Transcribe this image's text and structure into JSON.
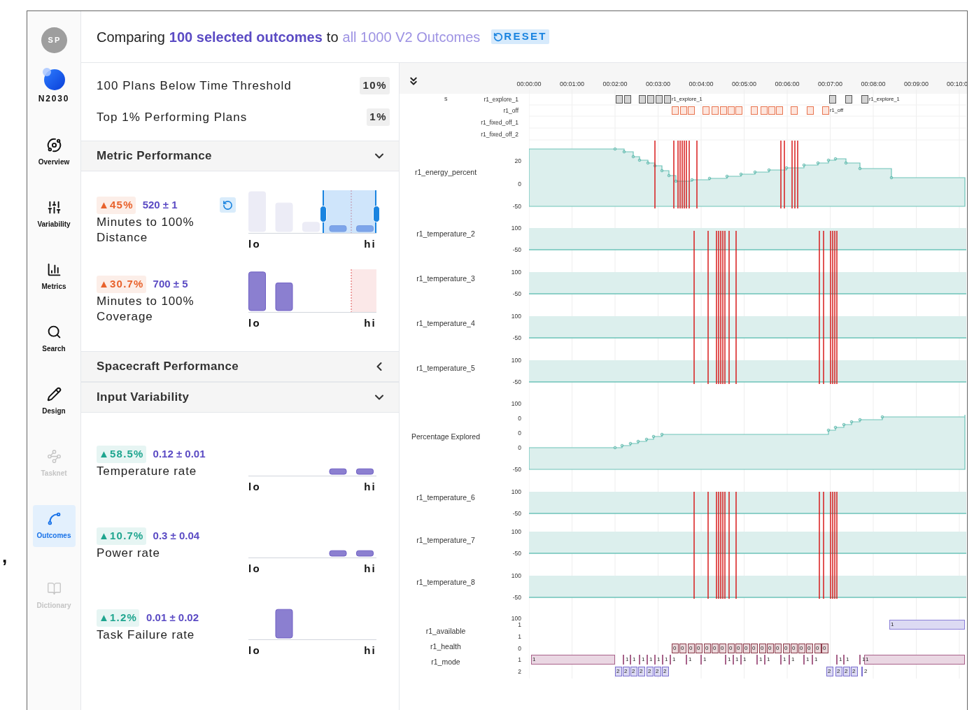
{
  "stray_mark": ",",
  "sidebar": {
    "avatar": "SP",
    "brand": "N2030",
    "items": [
      {
        "label": "Overview",
        "kind": "overview",
        "selected": false,
        "disabled": false
      },
      {
        "label": "Variability",
        "kind": "variability",
        "selected": false,
        "disabled": false
      },
      {
        "label": "Metrics",
        "kind": "metrics",
        "selected": false,
        "disabled": false
      },
      {
        "label": "Search",
        "kind": "search",
        "selected": false,
        "disabled": false
      },
      {
        "label": "Design",
        "kind": "design",
        "selected": false,
        "disabled": false
      },
      {
        "label": "Tasknet",
        "kind": "tasknet",
        "selected": false,
        "disabled": true
      },
      {
        "label": "Outcomes",
        "kind": "outcomes",
        "selected": true,
        "disabled": false
      },
      {
        "label": "Dictionary",
        "kind": "dictionary",
        "selected": false,
        "disabled": true
      }
    ]
  },
  "header": {
    "prefix": "Comparing",
    "selection": "100 selected outcomes",
    "connector": "to",
    "baseline": "all 1000 V2 Outcomes",
    "reset": "RESET"
  },
  "thresholds": [
    {
      "label": "100 Plans Below Time Threshold",
      "value": "10%"
    },
    {
      "label": "Top 1% Performing Plans",
      "value": "1%"
    }
  ],
  "sections": [
    {
      "title": "Metric Performance",
      "expanded": true,
      "items": [
        {
          "delta": "▲45%",
          "color": "#e8622c",
          "value": "520 ± 1",
          "label": "Minutes to 100% Distance",
          "resettable": true,
          "histogram": {
            "kind": "range",
            "lo": "lo",
            "hi": "hi"
          }
        },
        {
          "delta": "▲30.7%",
          "color": "#e8622c",
          "value": "700 ± 5",
          "label": "Minutes to 100% Coverage",
          "resettable": false,
          "histogram": {
            "kind": "threshold",
            "lo": "lo",
            "hi": "hi"
          }
        }
      ]
    },
    {
      "title": "Spacecraft Performance",
      "expanded": false
    },
    {
      "title": "Input Variability",
      "expanded": true,
      "items": [
        {
          "delta": "▲58.5%",
          "color": "#1fa58f",
          "value": "0.12 ± 0.01",
          "label": "Temperature rate",
          "resettable": false,
          "histogram": {
            "kind": "plain",
            "lo": "lo",
            "hi": "hi"
          }
        },
        {
          "delta": "▲10.7%",
          "color": "#1fa58f",
          "value": "0.3 ± 0.04",
          "label": "Power rate",
          "resettable": false,
          "histogram": {
            "kind": "plain",
            "lo": "lo",
            "hi": "hi"
          }
        },
        {
          "delta": "▲1.2%",
          "color": "#1fa58f",
          "value": "0.01 ± 0.02",
          "label": "Task Failure rate",
          "resettable": false,
          "histogram": {
            "kind": "plain",
            "lo": "lo",
            "hi": "hi"
          }
        }
      ]
    }
  ],
  "timeline": {
    "time_ticks": [
      "00:00:00",
      "00:01:00",
      "00:02:00",
      "00:03:00",
      "00:04:00",
      "00:05:00",
      "00:06:00",
      "00:07:00",
      "00:08:00",
      "00:09:00",
      "00:10:0"
    ],
    "group_label": "s",
    "event_tracks": [
      {
        "label": "r1_explore_1",
        "color": "#555555",
        "labels": [
          "r1_explore_1",
          "r1_explore_1"
        ]
      },
      {
        "label": "r1_off",
        "color": "#e8744f",
        "labels": [
          "r1_off"
        ]
      },
      {
        "label": "r1_fixed_off_1"
      },
      {
        "label": "r1_fixed_off_2"
      }
    ],
    "chart_tracks": [
      {
        "kind": "line",
        "label": "r1_energy_percent",
        "ticks": [
          "20",
          "0",
          "-50"
        ]
      },
      {
        "kind": "band",
        "label": "r1_temperature_2",
        "ticks": [
          "100",
          "-50"
        ]
      },
      {
        "kind": "band",
        "label": "r1_temperature_3",
        "ticks": [
          "100",
          "-50"
        ]
      },
      {
        "kind": "band",
        "label": "r1_temperature_4",
        "ticks": [
          "100",
          "-50"
        ]
      },
      {
        "kind": "band",
        "label": "r1_temperature_5",
        "ticks": [
          "100",
          "-50"
        ]
      },
      {
        "kind": "line",
        "label": "Percentage Explored",
        "ticks": [
          "100",
          "0",
          "0",
          "0",
          "-50"
        ]
      },
      {
        "kind": "band",
        "label": "r1_temperature_6",
        "ticks": [
          "100",
          "-50"
        ]
      },
      {
        "kind": "band",
        "label": "r1_temperature_7",
        "ticks": [
          "100",
          "-50"
        ]
      },
      {
        "kind": "band",
        "label": "r1_temperature_8",
        "ticks": [
          "100",
          "-50"
        ]
      }
    ],
    "state_ticks": [
      "100",
      "1",
      "1",
      "0",
      "1",
      "2"
    ],
    "state_labels": [
      "r1_available",
      "r1_health",
      "r1_mode"
    ],
    "state_lanes": [
      {
        "kind": "spans",
        "color": "#8b80d8",
        "values": [
          "1"
        ]
      },
      {
        "kind": "boxes",
        "color": "#8b3a4a",
        "values": [
          "0",
          "0",
          "0",
          "0",
          "0",
          "0",
          "0",
          "0",
          "0",
          "0",
          "0",
          "0",
          "0",
          "0",
          "0",
          "0",
          "0",
          "0",
          "0",
          "0"
        ]
      },
      {
        "kind": "marks",
        "color": "#a8628a",
        "values": [
          "1",
          "1",
          "1",
          "1",
          "1",
          "1",
          "1",
          "1",
          "1",
          "1",
          "1",
          "1",
          "1",
          "1",
          "1",
          "1",
          "1",
          "1",
          "1",
          "1",
          "1",
          "1",
          "1"
        ]
      },
      {
        "kind": "boxes",
        "color": "#7b6fd0",
        "values": [
          "2",
          "2",
          "2",
          "2",
          "2",
          "2",
          "2",
          "2",
          "2",
          "2",
          "2",
          "2"
        ]
      }
    ]
  }
}
